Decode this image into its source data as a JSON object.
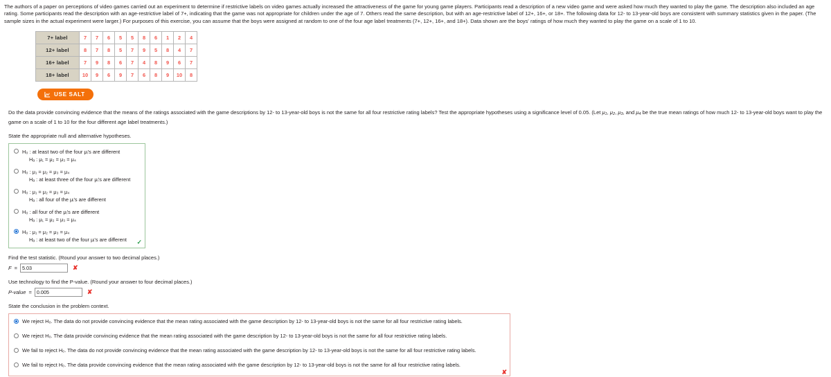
{
  "intro": {
    "paragraph": "The authors of a paper on perceptions of video games carried out an experiment to determine if restrictive labels on video games actually increased the attractiveness of the game for young game players. Participants read a description of a new video game and were asked how much they wanted to play the game. The description also included an age rating. Some participants read the description with an age-restrictive label of 7+, indicating that the game was not appropriate for children under the age of 7. Others read the same description, but with an age-restrictive label of 12+, 16+, or 18+. The following data for 12- to 13-year-old boys are consistent with summary statistics given in the paper. (The sample sizes in the actual experiment were larger.) For purposes of this exercise, you can assume that the boys were assigned at random to one of the four age label treatments (7+, 12+, 16+, and 18+). Data shown are the boys' ratings of how much they wanted to play the game on a scale of 1 to 10."
  },
  "data_table": {
    "rows": [
      {
        "label": "7+ label",
        "values": [
          7,
          7,
          6,
          5,
          5,
          8,
          6,
          1,
          2,
          4
        ]
      },
      {
        "label": "12+ label",
        "values": [
          8,
          7,
          8,
          5,
          7,
          9,
          5,
          8,
          4,
          7
        ]
      },
      {
        "label": "16+ label",
        "values": [
          7,
          9,
          8,
          6,
          7,
          4,
          8,
          9,
          6,
          7
        ]
      },
      {
        "label": "18+ label",
        "values": [
          10,
          9,
          6,
          9,
          7,
          6,
          8,
          9,
          10,
          8
        ]
      }
    ]
  },
  "salt": {
    "label": "USE SALT",
    "icon": "chart-icon",
    "color": "#f4700a"
  },
  "question": {
    "prompt_part1": "Do the data provide convincing evidence that the means of the ratings associated with the game descriptions by 12- to 13-year-old boys is not the same for all four restrictive rating labels? Test the appropriate hypotheses using a significance level of 0.05. (Let ",
    "mu1": "μ",
    "prompt_part2": " be the true mean ratings of how much 12- to 13-year-old boys want to play the game on a scale of 1 to 10 for the four different age label treatments.)",
    "state_hypotheses": "State the appropriate null and alternative hypotheses."
  },
  "hypotheses": {
    "options": [
      {
        "null_text": "H₀ : at least two of the four μᵢ's are different",
        "alt_text": "Hₐ : μ₁ = μ₂ = μ₃ = μ₄",
        "selected": false
      },
      {
        "null_text": "H₀ : μ₁ = μ₂ = μ₃ = μ₄",
        "alt_text": "Hₐ : at least three of the four μᵢ's are different",
        "selected": false
      },
      {
        "null_text": "H₀ : μ₁ = μ₂ = μ₃ = μ₄",
        "alt_text": "Hₐ : all four of the μᵢ's are different",
        "selected": false
      },
      {
        "null_text": "H₀ : all four of the μᵢ's are different",
        "alt_text": "Hₐ : μ₁ = μ₂ = μ₃ = μ₄",
        "selected": false
      },
      {
        "null_text": "H₀ : μ₁ = μ₂ = μ₃ = μ₄",
        "alt_text": "Hₐ : at least two of the four μᵢ's are different",
        "selected": true
      }
    ],
    "correct_mark": "✓"
  },
  "test_statistic": {
    "instruction": "Find the test statistic. (Round your answer to two decimal places.)",
    "var_label": "F",
    "equals": "=",
    "value": "5.03",
    "mark": "✘"
  },
  "p_value": {
    "instruction": "Use technology to find the P-value. (Round your answer to four decimal places.)",
    "var_label": "P-value",
    "equals": "=",
    "value": "0.005",
    "mark": "✘"
  },
  "conclusion": {
    "instruction": "State the conclusion in the problem context.",
    "options": [
      {
        "text": "We reject H₀. The data do not provide convincing evidence that the mean rating associated with the game description by 12- to 13-year-old boys is not the same for all four restrictive rating labels.",
        "selected": true
      },
      {
        "text": "We reject H₀. The data provide convincing evidence that the mean rating associated with the game description by 12- to 13-year-old boys is not the same for all four restrictive rating labels.",
        "selected": false
      },
      {
        "text": "We fail to reject H₀. The data do not provide convincing evidence that the mean rating associated with the game description by 12- to 13-year-old boys is not the same for all four restrictive rating labels.",
        "selected": false
      },
      {
        "text": "We fail to reject H₀. The data provide convincing evidence that the mean rating associated with the game description by 12- to 13-year-old boys is not the same for all four restrictive rating labels.",
        "selected": false
      }
    ],
    "mark": "✘"
  }
}
